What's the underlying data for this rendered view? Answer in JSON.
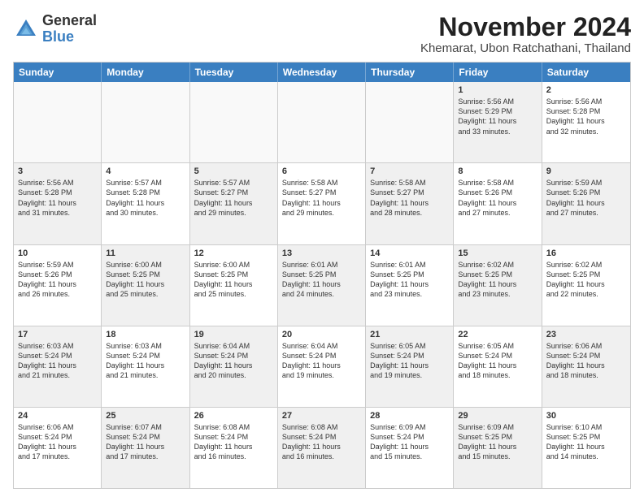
{
  "logo": {
    "general": "General",
    "blue": "Blue"
  },
  "title": "November 2024",
  "subtitle": "Khemarat, Ubon Ratchathani, Thailand",
  "days": [
    "Sunday",
    "Monday",
    "Tuesday",
    "Wednesday",
    "Thursday",
    "Friday",
    "Saturday"
  ],
  "rows": [
    [
      {
        "day": "",
        "text": "",
        "empty": true
      },
      {
        "day": "",
        "text": "",
        "empty": true
      },
      {
        "day": "",
        "text": "",
        "empty": true
      },
      {
        "day": "",
        "text": "",
        "empty": true
      },
      {
        "day": "",
        "text": "",
        "empty": true
      },
      {
        "day": "1",
        "text": "Sunrise: 5:56 AM\nSunset: 5:29 PM\nDaylight: 11 hours\nand 33 minutes.",
        "shaded": true
      },
      {
        "day": "2",
        "text": "Sunrise: 5:56 AM\nSunset: 5:28 PM\nDaylight: 11 hours\nand 32 minutes.",
        "shaded": false
      }
    ],
    [
      {
        "day": "3",
        "text": "Sunrise: 5:56 AM\nSunset: 5:28 PM\nDaylight: 11 hours\nand 31 minutes.",
        "shaded": true
      },
      {
        "day": "4",
        "text": "Sunrise: 5:57 AM\nSunset: 5:28 PM\nDaylight: 11 hours\nand 30 minutes.",
        "shaded": false
      },
      {
        "day": "5",
        "text": "Sunrise: 5:57 AM\nSunset: 5:27 PM\nDaylight: 11 hours\nand 29 minutes.",
        "shaded": true
      },
      {
        "day": "6",
        "text": "Sunrise: 5:58 AM\nSunset: 5:27 PM\nDaylight: 11 hours\nand 29 minutes.",
        "shaded": false
      },
      {
        "day": "7",
        "text": "Sunrise: 5:58 AM\nSunset: 5:27 PM\nDaylight: 11 hours\nand 28 minutes.",
        "shaded": true
      },
      {
        "day": "8",
        "text": "Sunrise: 5:58 AM\nSunset: 5:26 PM\nDaylight: 11 hours\nand 27 minutes.",
        "shaded": false
      },
      {
        "day": "9",
        "text": "Sunrise: 5:59 AM\nSunset: 5:26 PM\nDaylight: 11 hours\nand 27 minutes.",
        "shaded": true
      }
    ],
    [
      {
        "day": "10",
        "text": "Sunrise: 5:59 AM\nSunset: 5:26 PM\nDaylight: 11 hours\nand 26 minutes.",
        "shaded": false
      },
      {
        "day": "11",
        "text": "Sunrise: 6:00 AM\nSunset: 5:25 PM\nDaylight: 11 hours\nand 25 minutes.",
        "shaded": true
      },
      {
        "day": "12",
        "text": "Sunrise: 6:00 AM\nSunset: 5:25 PM\nDaylight: 11 hours\nand 25 minutes.",
        "shaded": false
      },
      {
        "day": "13",
        "text": "Sunrise: 6:01 AM\nSunset: 5:25 PM\nDaylight: 11 hours\nand 24 minutes.",
        "shaded": true
      },
      {
        "day": "14",
        "text": "Sunrise: 6:01 AM\nSunset: 5:25 PM\nDaylight: 11 hours\nand 23 minutes.",
        "shaded": false
      },
      {
        "day": "15",
        "text": "Sunrise: 6:02 AM\nSunset: 5:25 PM\nDaylight: 11 hours\nand 23 minutes.",
        "shaded": true
      },
      {
        "day": "16",
        "text": "Sunrise: 6:02 AM\nSunset: 5:25 PM\nDaylight: 11 hours\nand 22 minutes.",
        "shaded": false
      }
    ],
    [
      {
        "day": "17",
        "text": "Sunrise: 6:03 AM\nSunset: 5:24 PM\nDaylight: 11 hours\nand 21 minutes.",
        "shaded": true
      },
      {
        "day": "18",
        "text": "Sunrise: 6:03 AM\nSunset: 5:24 PM\nDaylight: 11 hours\nand 21 minutes.",
        "shaded": false
      },
      {
        "day": "19",
        "text": "Sunrise: 6:04 AM\nSunset: 5:24 PM\nDaylight: 11 hours\nand 20 minutes.",
        "shaded": true
      },
      {
        "day": "20",
        "text": "Sunrise: 6:04 AM\nSunset: 5:24 PM\nDaylight: 11 hours\nand 19 minutes.",
        "shaded": false
      },
      {
        "day": "21",
        "text": "Sunrise: 6:05 AM\nSunset: 5:24 PM\nDaylight: 11 hours\nand 19 minutes.",
        "shaded": true
      },
      {
        "day": "22",
        "text": "Sunrise: 6:05 AM\nSunset: 5:24 PM\nDaylight: 11 hours\nand 18 minutes.",
        "shaded": false
      },
      {
        "day": "23",
        "text": "Sunrise: 6:06 AM\nSunset: 5:24 PM\nDaylight: 11 hours\nand 18 minutes.",
        "shaded": true
      }
    ],
    [
      {
        "day": "24",
        "text": "Sunrise: 6:06 AM\nSunset: 5:24 PM\nDaylight: 11 hours\nand 17 minutes.",
        "shaded": false
      },
      {
        "day": "25",
        "text": "Sunrise: 6:07 AM\nSunset: 5:24 PM\nDaylight: 11 hours\nand 17 minutes.",
        "shaded": true
      },
      {
        "day": "26",
        "text": "Sunrise: 6:08 AM\nSunset: 5:24 PM\nDaylight: 11 hours\nand 16 minutes.",
        "shaded": false
      },
      {
        "day": "27",
        "text": "Sunrise: 6:08 AM\nSunset: 5:24 PM\nDaylight: 11 hours\nand 16 minutes.",
        "shaded": true
      },
      {
        "day": "28",
        "text": "Sunrise: 6:09 AM\nSunset: 5:24 PM\nDaylight: 11 hours\nand 15 minutes.",
        "shaded": false
      },
      {
        "day": "29",
        "text": "Sunrise: 6:09 AM\nSunset: 5:25 PM\nDaylight: 11 hours\nand 15 minutes.",
        "shaded": true
      },
      {
        "day": "30",
        "text": "Sunrise: 6:10 AM\nSunset: 5:25 PM\nDaylight: 11 hours\nand 14 minutes.",
        "shaded": false
      }
    ]
  ]
}
